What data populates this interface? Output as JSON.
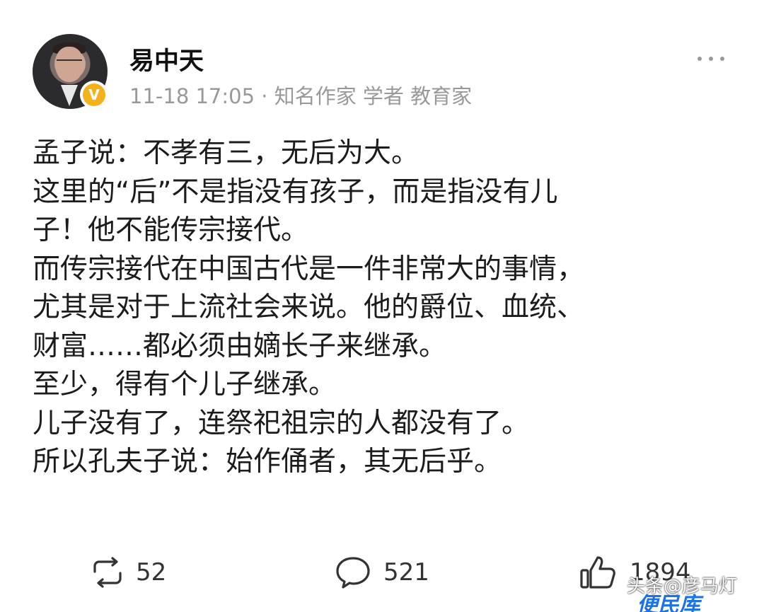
{
  "post": {
    "author": "易中天",
    "meta": "11-18 17:05 · 知名作家 学者 教育家",
    "verified_mark": "V",
    "lines": [
      "孟子说：不孝有三，无后为大。",
      "这里的“后”不是指没有孩子，而是指没有儿",
      "子！他不能传宗接代。",
      "而传宗接代在中国古代是一件非常大的事情，",
      "尤其是对于上流社会来说。他的爵位、血统、",
      "财富……都必须由嫡长子来继承。",
      "至少，得有个儿子继承。",
      "儿子没有了，连祭祀祖宗的人都没有了。",
      "所以孔夫子说：始作俑者，其无后乎。"
    ]
  },
  "actions": {
    "repost_count": "52",
    "comment_count": "521",
    "like_count": "1894"
  },
  "watermark": {
    "source": "头条@彦马灯",
    "site": "便民库"
  },
  "icons": {
    "more": "more-dots-icon",
    "repost": "repost-icon",
    "comment": "comment-icon",
    "like": "thumbs-up-icon",
    "verified": "verified-badge-icon"
  },
  "colors": {
    "verified_badge": "#f4b21a",
    "meta_text": "#999999",
    "body_text": "#1c1c1c"
  }
}
